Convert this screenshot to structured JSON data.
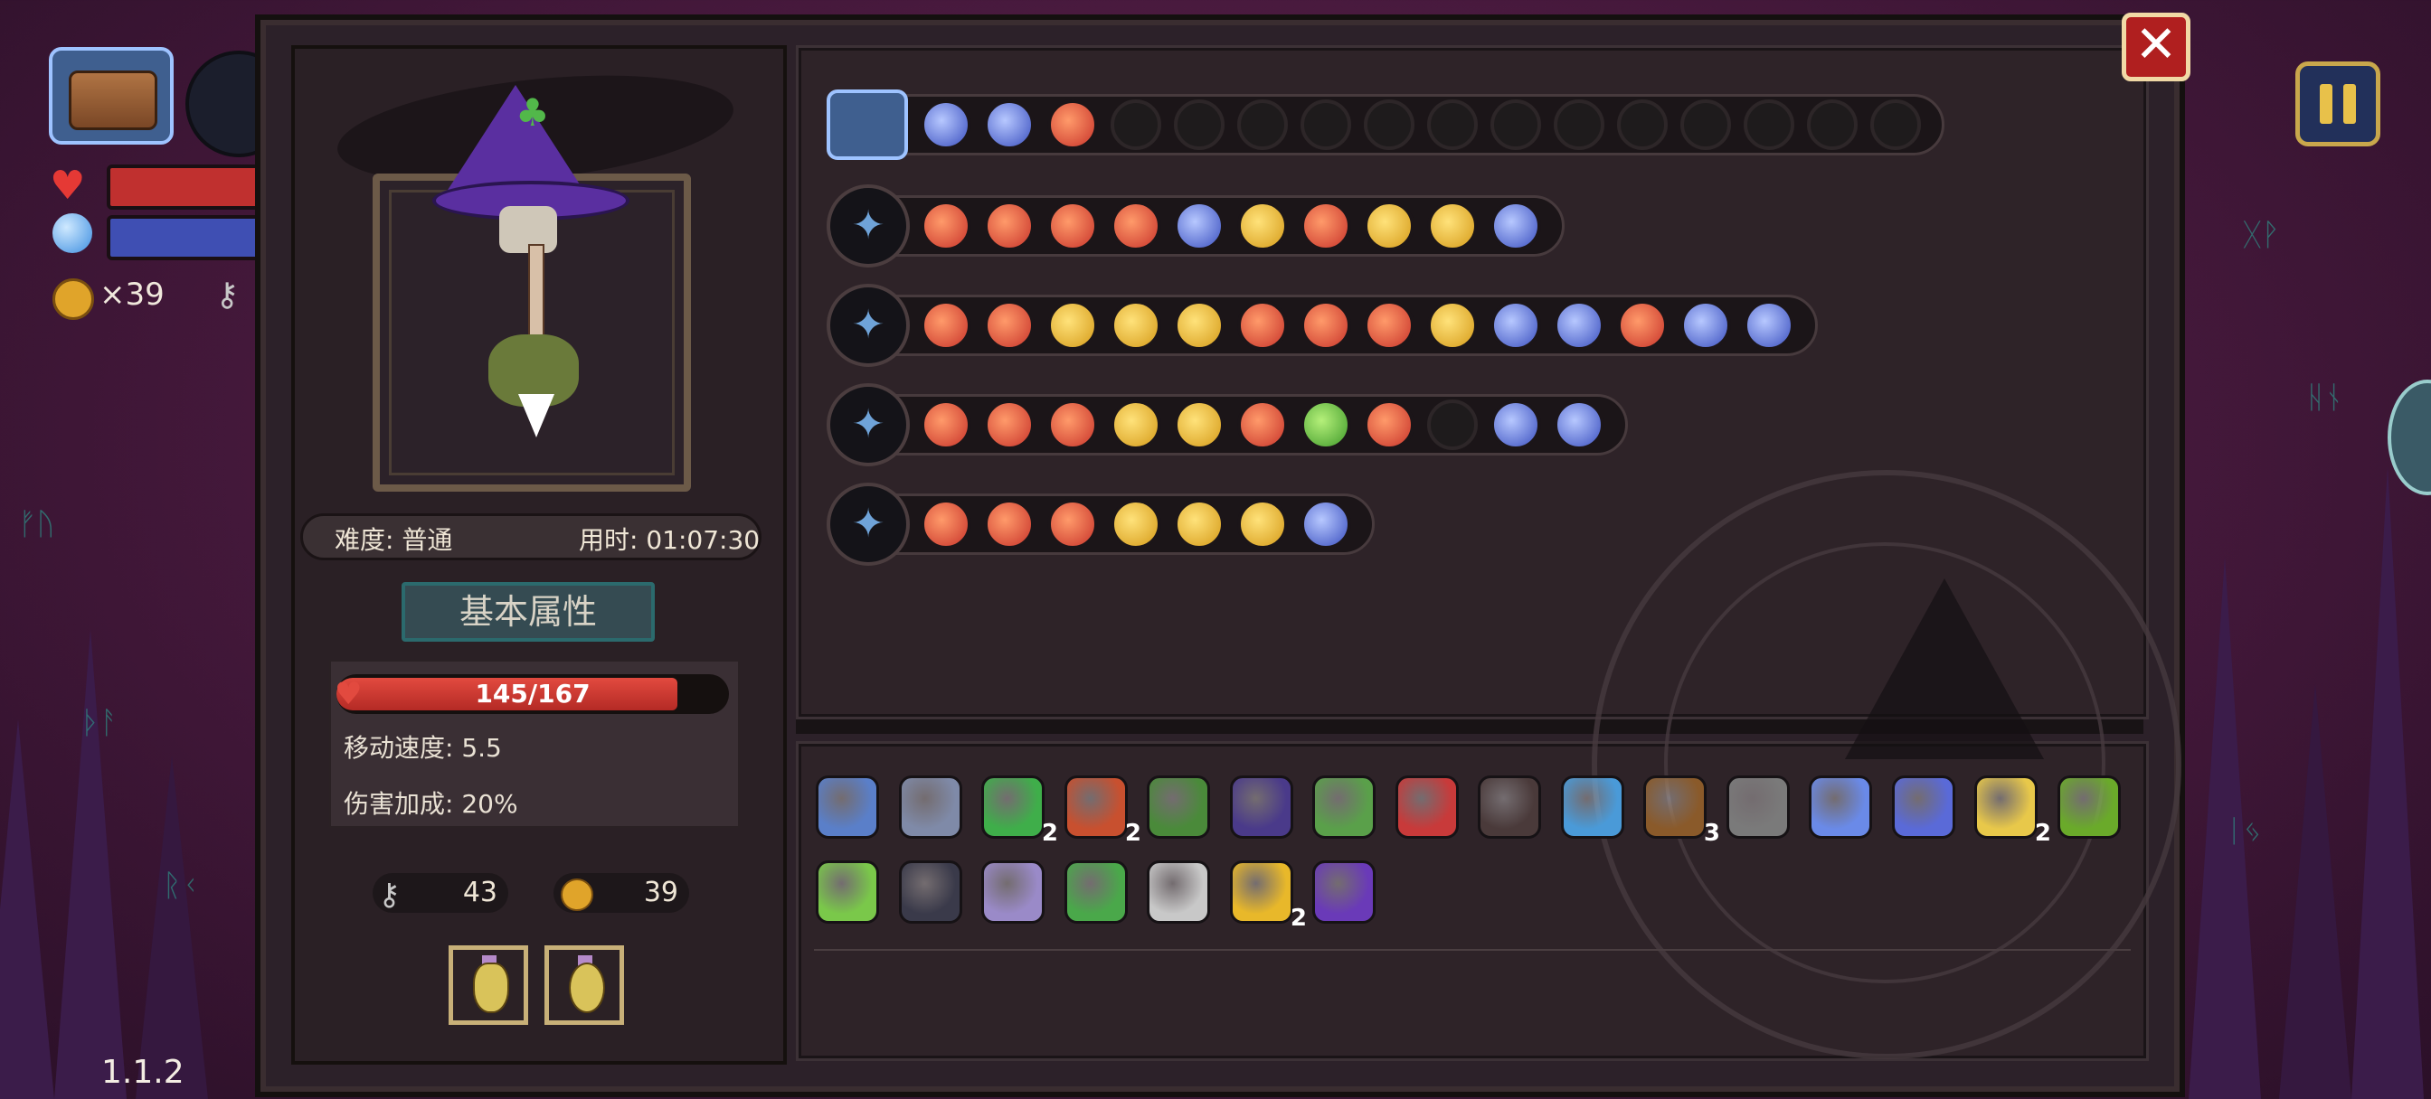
{
  "hud": {
    "coins_label": "×39",
    "version": "1.1.2"
  },
  "panel": {
    "difficulty": "难度: 普通",
    "time": "用时: 01:07:30",
    "attributes_title": "基本属性",
    "hp_text": "145/167",
    "hp_current": 145,
    "hp_max": 167,
    "move_speed": "移动速度: 5.5",
    "damage_bonus": "伤害加成: 20%",
    "keys": "43",
    "coins": "39"
  },
  "rows": [
    {
      "head": "chest",
      "skills": [
        "blue",
        "blue",
        "red",
        "empty",
        "empty",
        "empty",
        "empty",
        "empty",
        "empty",
        "empty",
        "empty",
        "empty",
        "empty",
        "empty",
        "empty",
        "empty"
      ]
    },
    {
      "head": "weapon",
      "skills": [
        "red",
        "red",
        "red",
        "red",
        "blue",
        "gold",
        "red",
        "gold",
        "gold",
        "blue"
      ]
    },
    {
      "head": "weapon",
      "skills": [
        "red",
        "red",
        "gold",
        "gold",
        "gold",
        "red",
        "red",
        "red",
        "gold",
        "blue",
        "blue",
        "red",
        "blue",
        "blue"
      ]
    },
    {
      "head": "weapon",
      "skills": [
        "red",
        "red",
        "red",
        "gold",
        "gold",
        "red",
        "green",
        "red",
        "empty",
        "blue",
        "blue"
      ]
    },
    {
      "head": "weapon",
      "skills": [
        "red",
        "red",
        "red",
        "gold",
        "gold",
        "gold",
        "blue"
      ]
    }
  ],
  "items": [
    {
      "icon": "shield-icon",
      "color": "#5a7fc9",
      "count": ""
    },
    {
      "icon": "rock-icon",
      "color": "#7f8aa8",
      "count": ""
    },
    {
      "icon": "clover-icon",
      "color": "#3fae4a",
      "count": "2"
    },
    {
      "icon": "horn-icon",
      "color": "#c8502f",
      "count": "2"
    },
    {
      "icon": "boot-icon",
      "color": "#4a8a3a",
      "count": ""
    },
    {
      "icon": "cape-icon",
      "color": "#4a3a8a",
      "count": ""
    },
    {
      "icon": "herb-icon",
      "color": "#5aa04a",
      "count": ""
    },
    {
      "icon": "snake-staff-icon",
      "color": "#c83a3a",
      "count": ""
    },
    {
      "icon": "bat-icon",
      "color": "#4a3a3a",
      "count": ""
    },
    {
      "icon": "ring-icon",
      "color": "#4a9ad8",
      "count": ""
    },
    {
      "icon": "armor-icon",
      "color": "#8a5a2a",
      "count": "3"
    },
    {
      "icon": "arrow-icon",
      "color": "#7a7a7a",
      "count": ""
    },
    {
      "icon": "mirror-icon",
      "color": "#6a8ae8",
      "count": ""
    },
    {
      "icon": "amulet-icon",
      "color": "#5a6ad8",
      "count": ""
    },
    {
      "icon": "cone-icon",
      "color": "#e8c84a",
      "count": "2"
    },
    {
      "icon": "pot-icon",
      "color": "#6aaa2a",
      "count": ""
    },
    {
      "icon": "syringe-icon",
      "color": "#7ac84a",
      "count": ""
    },
    {
      "icon": "helmet-icon",
      "color": "#3a3a4a",
      "count": ""
    },
    {
      "icon": "feather-icon",
      "color": "#9a8ac8",
      "count": ""
    },
    {
      "icon": "leaf-icon",
      "color": "#4aa84a",
      "count": ""
    },
    {
      "icon": "ribcage-icon",
      "color": "#c8c8c8",
      "count": ""
    },
    {
      "icon": "bell-icon",
      "color": "#e8b82a",
      "count": "2"
    },
    {
      "icon": "wizard-hat-icon",
      "color": "#6a3ab8",
      "count": ""
    }
  ]
}
